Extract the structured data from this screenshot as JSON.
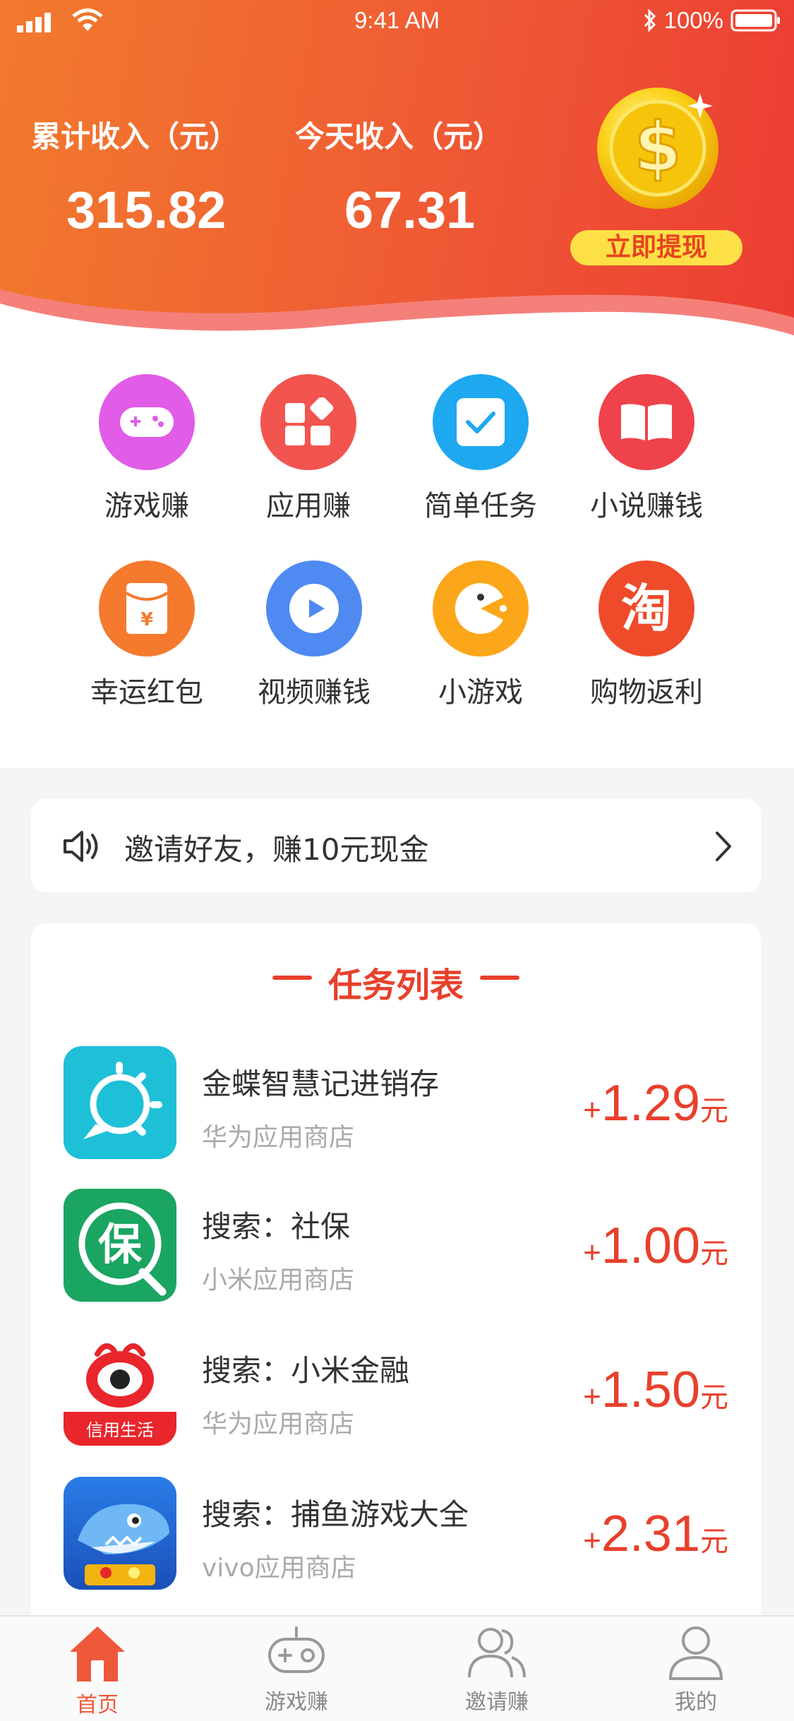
{
  "status_bar": {
    "time": "9:41 AM",
    "battery": "100%"
  },
  "header": {
    "total_income_label": "累计收入（元）",
    "total_income_value": "315.82",
    "today_income_label": "今天收入（元）",
    "today_income_value": "67.31",
    "withdraw_label": "立即提现"
  },
  "grid": [
    {
      "label": "游戏赚",
      "icon": "gamepad-icon",
      "color": "#e15ce7"
    },
    {
      "label": "应用赚",
      "icon": "apps-icon",
      "color": "#f2544f"
    },
    {
      "label": "简单任务",
      "icon": "checkbox-icon",
      "color": "#1da8f0"
    },
    {
      "label": "小说赚钱",
      "icon": "book-icon",
      "color": "#f0424a"
    },
    {
      "label": "幸运红包",
      "icon": "red-envelope-icon",
      "color": "#f57a2e"
    },
    {
      "label": "视频赚钱",
      "icon": "play-icon",
      "color": "#4e8af2"
    },
    {
      "label": "小游戏",
      "icon": "pacman-icon",
      "color": "#fca61a"
    },
    {
      "label": "购物返利",
      "icon": "taobao-icon",
      "color": "#ef4b2a"
    }
  ],
  "invite": {
    "text": "邀请好友，赚10元现金"
  },
  "tasks": {
    "title": "任务列表",
    "items": [
      {
        "name": "金蝶智慧记进销存",
        "source": "华为应用商店",
        "plus": "+",
        "amount": "1.29",
        "unit": "元"
      },
      {
        "name": "搜索：社保",
        "source": "小米应用商店",
        "plus": "+",
        "amount": "1.00",
        "unit": "元"
      },
      {
        "name": "搜索：小米金融",
        "source": "华为应用商店",
        "plus": "+",
        "amount": "1.50",
        "unit": "元",
        "badge": "信用生活"
      },
      {
        "name": "搜索：捕鱼游戏大全",
        "source": "vivo应用商店",
        "plus": "+",
        "amount": "2.31",
        "unit": "元"
      }
    ]
  },
  "tabbar": [
    {
      "label": "首页",
      "active": true
    },
    {
      "label": "游戏赚",
      "active": false
    },
    {
      "label": "邀请赚",
      "active": false
    },
    {
      "label": "我的",
      "active": false
    }
  ],
  "colors": {
    "accent": "#e8402c",
    "gold": "#fde046",
    "active_tab": "#f0583a"
  }
}
